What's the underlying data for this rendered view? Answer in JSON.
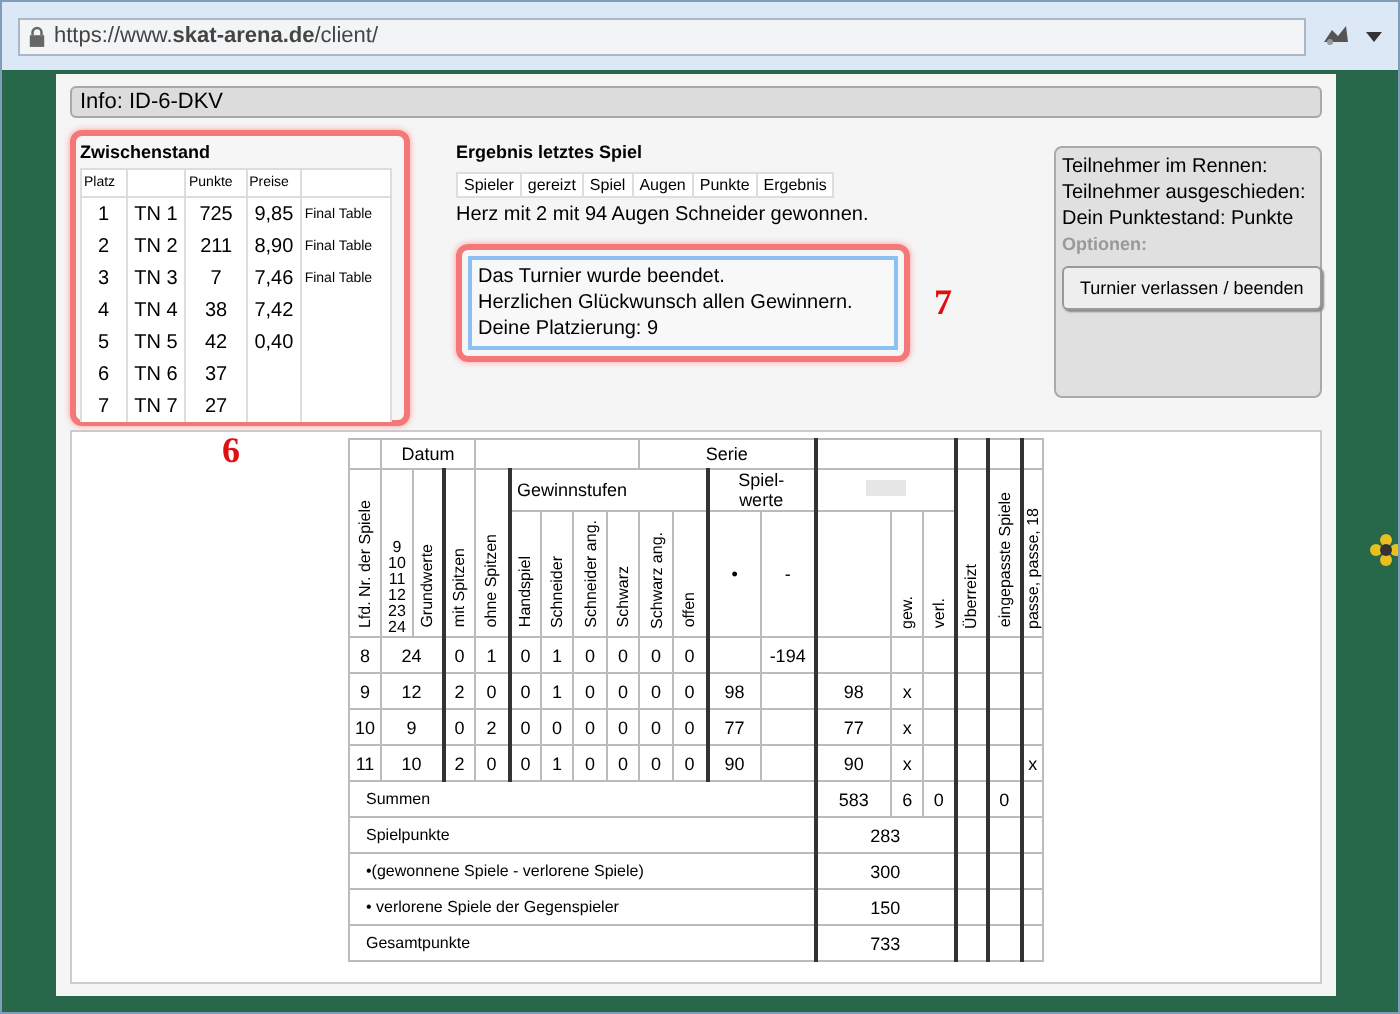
{
  "browser": {
    "url": "https://www.**skat-arena.de**/client/"
  },
  "info": "Info: ID-6-DKV",
  "standings": {
    "title": "Zwischenstand",
    "headers": {
      "platz": "Platz",
      "punkte": "Punkte",
      "preise": "Preise"
    },
    "rows": [
      {
        "platz": "1",
        "name": "TN 1",
        "punkte": "725",
        "preis": "9,85",
        "note": "Final Table"
      },
      {
        "platz": "2",
        "name": "TN 2",
        "punkte": "211",
        "preis": "8,90",
        "note": "Final Table"
      },
      {
        "platz": "3",
        "name": "TN 3",
        "punkte": "7",
        "preis": "7,46",
        "note": "Final Table"
      },
      {
        "platz": "4",
        "name": "TN 4",
        "punkte": "38",
        "preis": "7,42"
      },
      {
        "platz": "5",
        "name": "TN 5",
        "punkte": "42",
        "preis": "0,40"
      },
      {
        "platz": "6",
        "name": "TN 6",
        "punkte": "37"
      },
      {
        "platz": "7",
        "name": "TN 7",
        "punkte": "27"
      }
    ]
  },
  "callouts": [
    {
      "label": "6"
    },
    {
      "label": "7"
    }
  ],
  "last_game": {
    "title": "Ergebnis letztes Spiel",
    "columns": [
      "Spieler",
      "gereizt",
      "Spiel",
      "Augen",
      "Punkte",
      "Ergebnis"
    ],
    "result": "Herz mit 2 mit 94 Augen Schneider gewonnen."
  },
  "message": {
    "lines": [
      "Das Turnier wurde beendet.",
      "Herzlichen Glückwunsch allen Gewinnern.",
      "Deine Platzierung: 9"
    ]
  },
  "status_panel": {
    "lines": [
      "Teilnehmer im Rennen:",
      "Teilnehmer ausgeschieden:",
      "Dein Punktestand: Punkte"
    ],
    "options_label": "Optionen:",
    "button": "Turnier verlassen / beenden"
  },
  "score_sheet": {
    "datum": "Datum",
    "serie": "Serie",
    "lfd": "Lfd. Nr. der Spiele",
    "grundwert_values": [
      "9",
      "10",
      "11",
      "12",
      "23",
      "24"
    ],
    "grundwerte": "Grundwerte",
    "spitzen": [
      "mit Spitzen",
      "ohne Spitzen"
    ],
    "gewinnstufen_title": "Gewinnstufen",
    "gewinnstufen": [
      "Handspiel",
      "Schneider",
      "Schneider ang.",
      "Schwarz",
      "Schwarz ang.",
      "offen"
    ],
    "spielwerte": [
      "Spiel-",
      "werte"
    ],
    "signs": [
      "•",
      "-"
    ],
    "gew": "gew.",
    "verl": "verl.",
    "ueberreizt": "Überreizt",
    "eingepasst": "eingepasste Spiele",
    "passe": "passe, passe, 18",
    "rows": [
      {
        "nr": "8",
        "grund": "24",
        "mit": "0",
        "ohne": "1",
        "stufen": [
          "0",
          "1",
          "0",
          "0",
          "0",
          "0"
        ],
        "minus": "-194"
      },
      {
        "nr": "9",
        "grund": "12",
        "mit": "2",
        "ohne": "0",
        "stufen": [
          "0",
          "1",
          "0",
          "0",
          "0",
          "0"
        ],
        "plus": "98",
        "wert": "98",
        "gew": "x"
      },
      {
        "nr": "10",
        "grund": "9",
        "mit": "0",
        "ohne": "2",
        "stufen": [
          "0",
          "0",
          "0",
          "0",
          "0",
          "0"
        ],
        "plus": "77",
        "wert": "77",
        "gew": "x"
      },
      {
        "nr": "11",
        "grund": "10",
        "mit": "2",
        "ohne": "0",
        "stufen": [
          "0",
          "1",
          "0",
          "0",
          "0",
          "0"
        ],
        "plus": "90",
        "wert": "90",
        "gew": "x",
        "passe": "x"
      }
    ],
    "totals": {
      "label": "Summen",
      "wert": "583",
      "gew": "6",
      "verl": "0",
      "eingepasst": "0"
    },
    "summary": [
      {
        "label": "Spielpunkte",
        "value": "283"
      },
      {
        "label": "•(gewonnene Spiele - verlorene Spiele)",
        "value": "300"
      },
      {
        "label": "• verlorene Spiele der Gegenspieler",
        "value": "150"
      },
      {
        "label": "Gesamtpunkte",
        "value": "733"
      }
    ]
  }
}
